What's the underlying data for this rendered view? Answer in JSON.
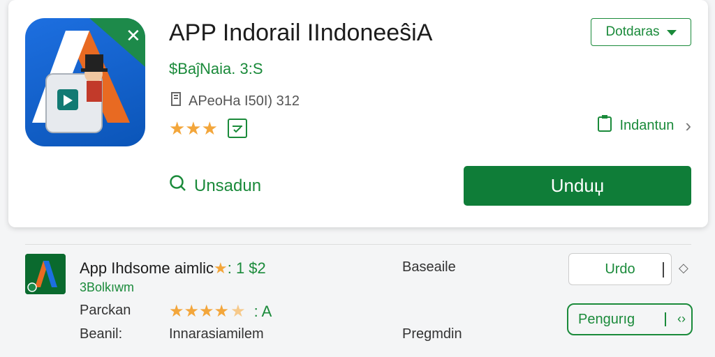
{
  "app": {
    "title": "APP Indorail IIndoneeŝiA",
    "price": "$BaĵNaia. 3:S",
    "developer": "APeoHa I50I) 312",
    "stars": "★★★"
  },
  "header": {
    "dropdown_label": "Dotdaras",
    "install_label": "Indantun",
    "search_label": "Unsadun",
    "download_label": "Unduџ"
  },
  "list_row": {
    "title": "App Ihdsome aimlic",
    "title_star": "★",
    "title_suffix": ": 1 $2",
    "subtitle": "3Bolkıwm",
    "label_left_1": "Parckan",
    "label_left_2": "Beanil:",
    "label_mid_2": "Innarasiamilem",
    "label_right_1": "Baseaile",
    "label_right_2": "Pregmdin",
    "stars": "★★★★",
    "half_star": "★",
    "score": ": A",
    "small_button_label": "Urdo",
    "outline_button_label": "Pengurıg",
    "outline_button_code": "‹›"
  },
  "colors": {
    "accent": "#1a8a3a",
    "button_green": "#0f7d38",
    "icon_blue": "#1d6fe0",
    "star_orange": "#f3a63b"
  }
}
